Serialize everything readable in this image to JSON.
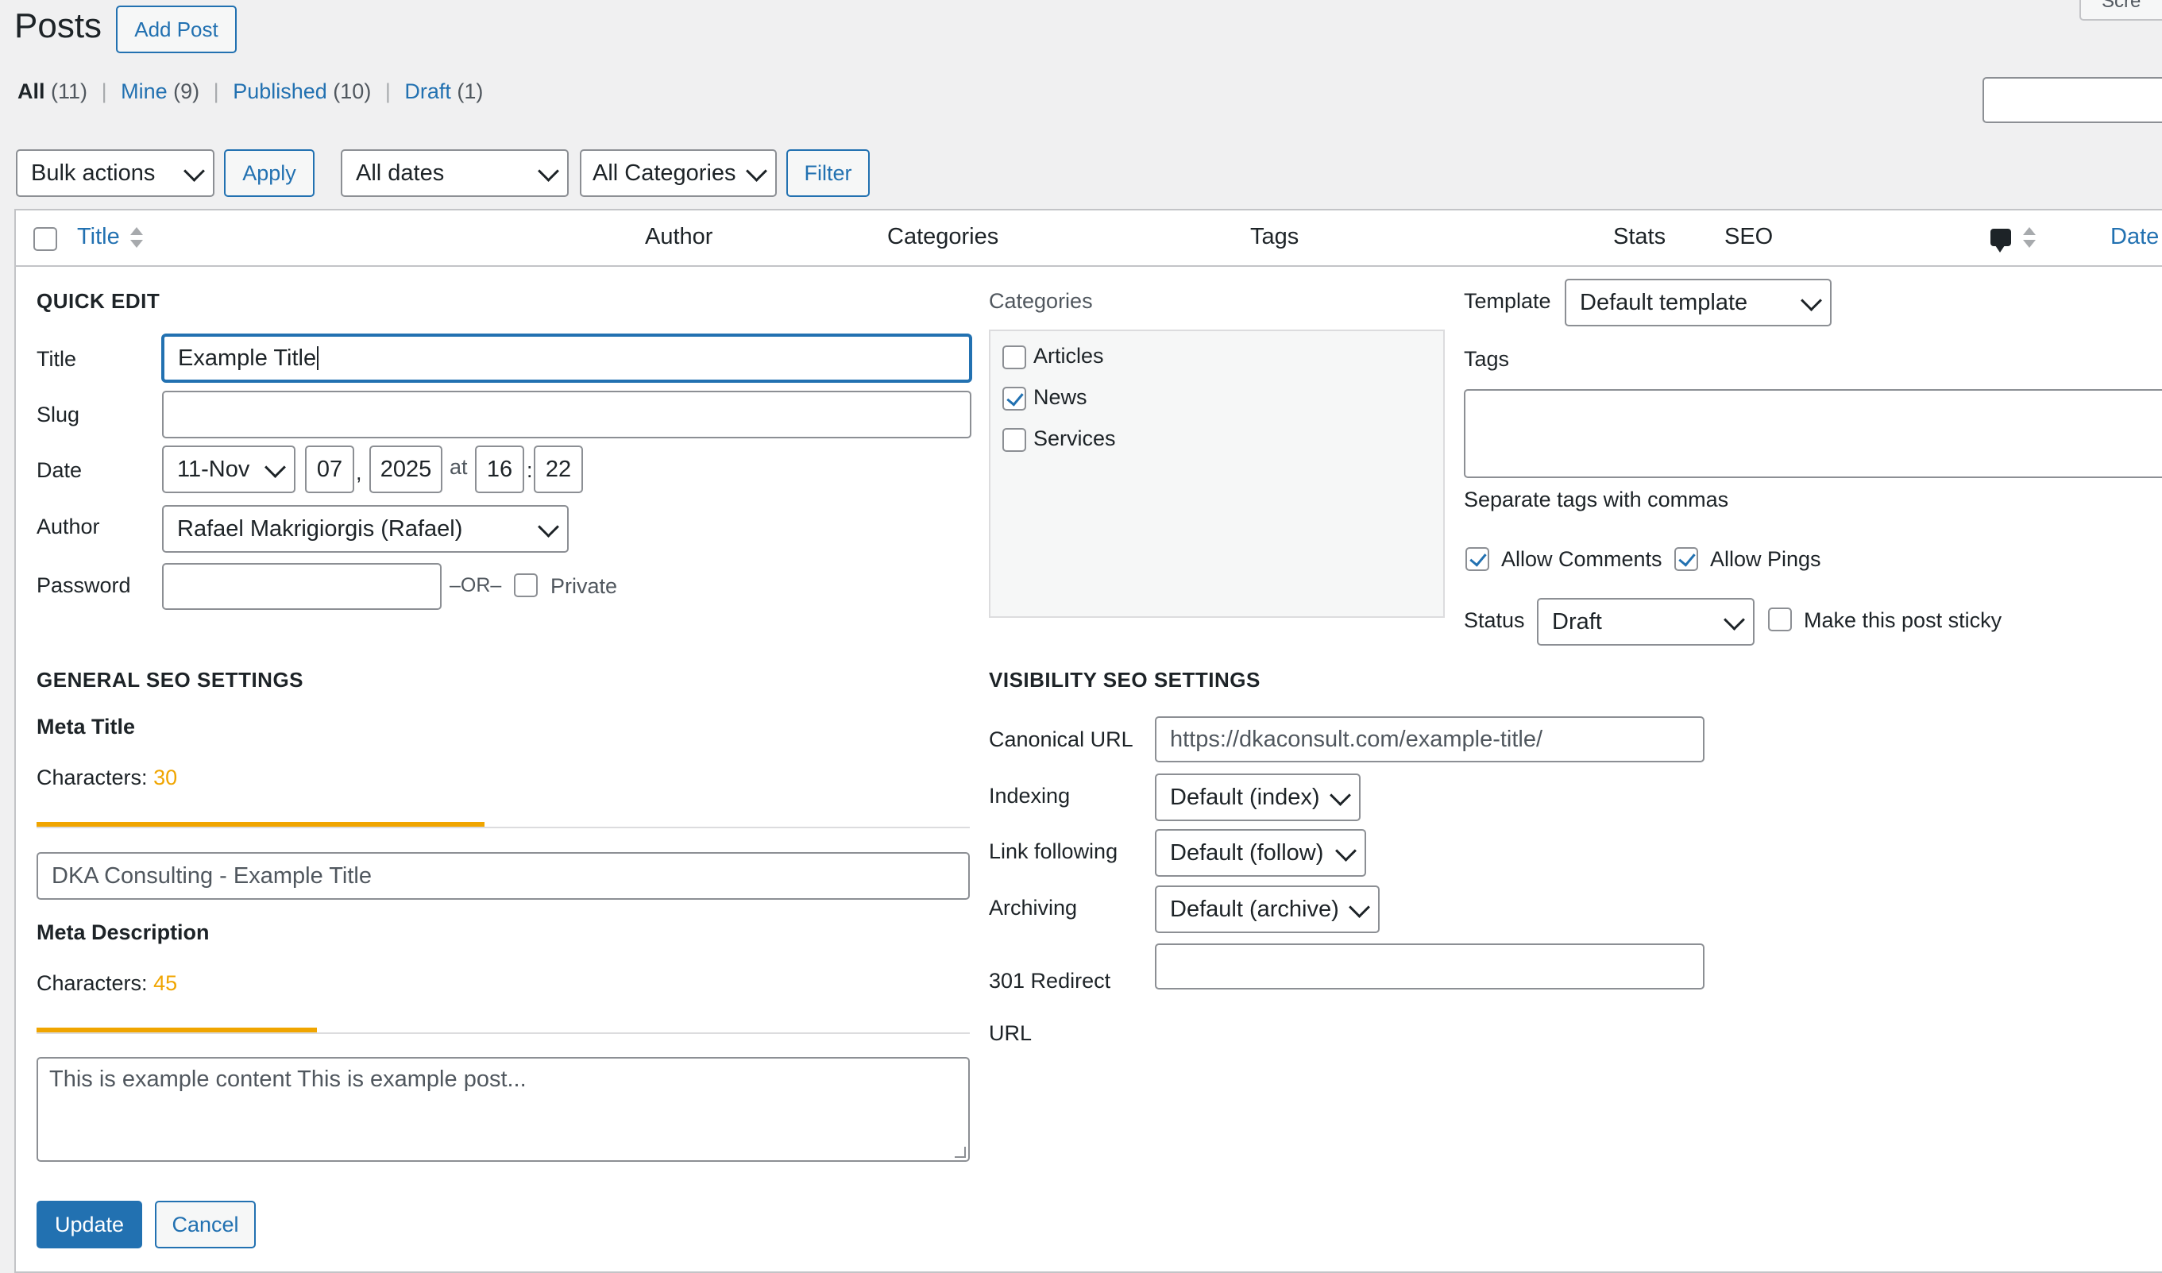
{
  "header": {
    "title": "Posts",
    "add_button": "Add Post",
    "screen_options_partial": "Scre"
  },
  "filters": {
    "all": {
      "label": "All",
      "count": "(11)"
    },
    "mine": {
      "label": "Mine",
      "count": "(9)"
    },
    "published": {
      "label": "Published",
      "count": "(10)"
    },
    "draft": {
      "label": "Draft",
      "count": "(1)"
    },
    "separator": "|"
  },
  "toolbar": {
    "bulk_actions": "Bulk actions",
    "apply": "Apply",
    "dates": "All dates",
    "categories": "All Categories",
    "filter": "Filter"
  },
  "table_header": {
    "title": "Title",
    "author": "Author",
    "categories": "Categories",
    "tags": "Tags",
    "stats": "Stats",
    "seo": "SEO",
    "date": "Date"
  },
  "quick_edit": {
    "heading": "QUICK EDIT",
    "title_label": "Title",
    "title_value": "Example Title",
    "slug_label": "Slug",
    "slug_value": "",
    "date_label": "Date",
    "month": "11-Nov",
    "day": "07",
    "comma": ",",
    "year": "2025",
    "at": "at",
    "hour": "16",
    "colon": ":",
    "minute": "22",
    "author_label": "Author",
    "author_value": "Rafael Makrigiorgis (Rafael)",
    "password_label": "Password",
    "password_value": "",
    "or_text": "–OR–",
    "private_label": "Private",
    "private_checked": false
  },
  "categories_box": {
    "label": "Categories",
    "items": [
      {
        "label": "Articles",
        "checked": false
      },
      {
        "label": "News",
        "checked": true
      },
      {
        "label": "Services",
        "checked": false
      }
    ]
  },
  "right_panel": {
    "template_label": "Template",
    "template_value": "Default template",
    "tags_label": "Tags",
    "tags_hint": "Separate tags with commas",
    "allow_comments": "Allow Comments",
    "allow_comments_checked": true,
    "allow_pings": "Allow Pings",
    "allow_pings_checked": true,
    "status_label": "Status",
    "status_value": "Draft",
    "sticky_label": "Make this post sticky",
    "sticky_checked": false
  },
  "general_seo": {
    "heading": "GENERAL SEO SETTINGS",
    "meta_title_label": "Meta Title",
    "characters_label": "Characters:",
    "meta_title_count": "30",
    "meta_title_fill_fraction": 0.48,
    "meta_title_value": "DKA Consulting - Example Title",
    "meta_desc_label": "Meta Description",
    "meta_desc_count": "45",
    "meta_desc_fill_fraction": 0.3,
    "meta_desc_value": "This is example content This is example post..."
  },
  "visibility_seo": {
    "heading": "VISIBILITY SEO SETTINGS",
    "canonical_label": "Canonical URL",
    "canonical_value": "https://dkaconsult.com/example-title/",
    "indexing_label": "Indexing",
    "indexing_value": "Default (index)",
    "link_following_label": "Link following",
    "link_following_value": "Default (follow)",
    "archiving_label": "Archiving",
    "archiving_value": "Default (archive)",
    "redirect_label_line1": "301 Redirect",
    "redirect_label_line2": "URL",
    "redirect_value": ""
  },
  "actions": {
    "update": "Update",
    "cancel": "Cancel"
  },
  "colors": {
    "accent": "#2271b1",
    "warning": "#f0a500",
    "background": "#f0f0f1"
  }
}
